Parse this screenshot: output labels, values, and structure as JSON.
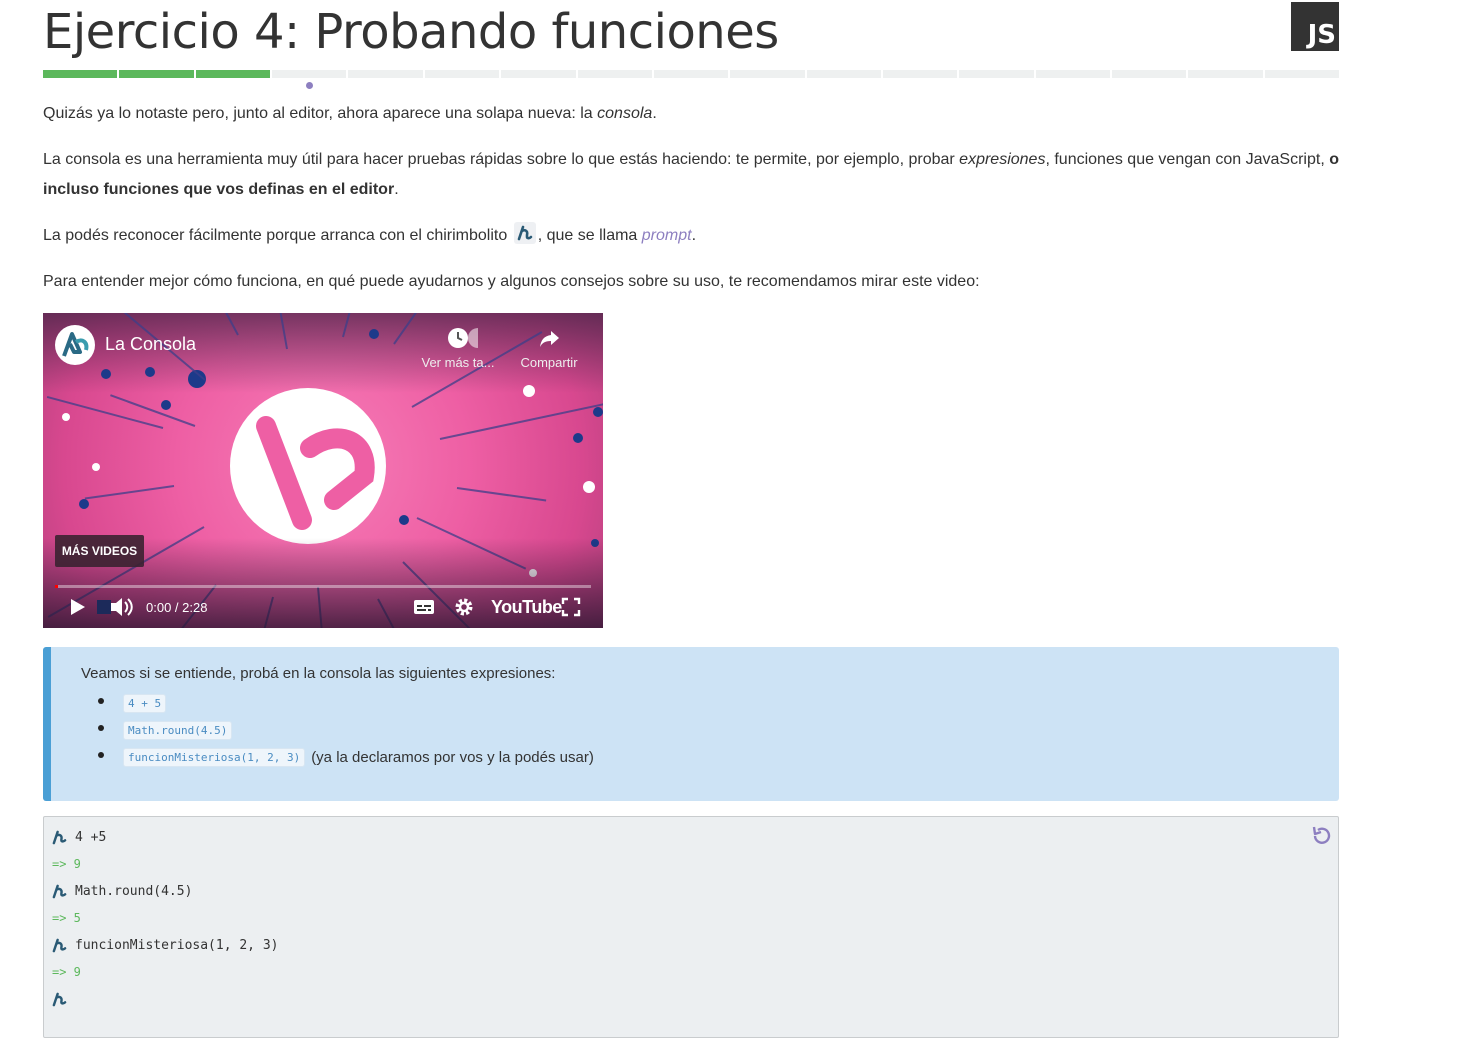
{
  "page": {
    "title": "Ejercicio 4: Probando funciones",
    "badge": "JS"
  },
  "progress": {
    "segments_total": 17,
    "segments_done": 3,
    "current_index": 4
  },
  "content": {
    "p1_before": "Quizás ya lo notaste pero, junto al editor, ahora aparece una solapa nueva: la ",
    "p1_em": "consola",
    "p1_after": ".",
    "p2_before": "La consola es una herramienta muy útil para hacer pruebas rápidas sobre lo que estás haciendo: te permite, por ejemplo, probar ",
    "p2_em": "expresiones",
    "p2_middle": ", funciones que vengan con JavaScript, ",
    "p2_strong": "o incluso funciones que vos definas en el editor",
    "p2_after": ".",
    "p3_before": "La podés reconocer fácilmente porque arranca con el chirimbolito ",
    "p3_middle": ", que se llama ",
    "p3_em": "prompt",
    "p3_after": ".",
    "p4": "Para entender mejor cómo funciona, en qué puede ayudarnos y algunos consejos sobre su uso, te recomendamos mirar este video:"
  },
  "video": {
    "title": "La Consola",
    "watch_later": "Ver más ta...",
    "share": "Compartir",
    "more_videos": "MÁS VIDEOS",
    "time": "0:00 / 2:28",
    "brand": "YouTube",
    "progress": 0.0
  },
  "exercise": {
    "intro": "Veamos si se entiende, probá en la consola las siguientes expresiones:",
    "items": [
      {
        "code": "4 + 5",
        "note": ""
      },
      {
        "code": "Math.round(4.5)",
        "note": ""
      },
      {
        "code": "funcionMisteriosa(1, 2, 3)",
        "note": "(ya la declaramos por vos y la podés usar)"
      }
    ]
  },
  "console": {
    "lines": [
      {
        "type": "input",
        "text": "4 +5"
      },
      {
        "type": "output",
        "text": "=> 9"
      },
      {
        "type": "input",
        "text": "Math.round(4.5)"
      },
      {
        "type": "output",
        "text": "=> 5"
      },
      {
        "type": "input",
        "text": "funcionMisteriosa(1, 2, 3)"
      },
      {
        "type": "output",
        "text": "=> 9"
      },
      {
        "type": "input",
        "text": ""
      }
    ]
  },
  "colors": {
    "progress_done": "#5cb85c",
    "progress_todo": "#eef0f0",
    "accent_purple": "#8d7fc0",
    "info_bg": "#cde3f5",
    "info_border": "#4a9fd5",
    "console_output": "#5cb85c",
    "video_pink": "#ee5fa4"
  },
  "icons": {
    "prompt": "mumuki-prompt-icon",
    "reset": "reset-icon",
    "play": "play-icon",
    "volume": "volume-icon",
    "captions": "captions-icon",
    "settings": "gear-icon",
    "fullscreen": "fullscreen-icon",
    "clock": "clock-icon",
    "share": "share-icon"
  }
}
